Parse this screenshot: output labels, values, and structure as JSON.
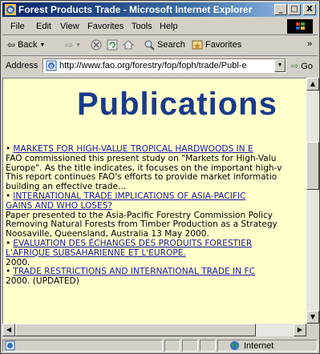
{
  "window": {
    "title": "Forest Products Trade - Microsoft Internet Explorer",
    "minimize_label": "_",
    "maximize_label": "□",
    "close_label": "X"
  },
  "menu": [
    "File",
    "Edit",
    "View",
    "Favorites",
    "Tools",
    "Help"
  ],
  "toolbar": {
    "back_label": "Back",
    "search_label": "Search",
    "favorites_label": "Favorites",
    "more_label": "»"
  },
  "address": {
    "label": "Address",
    "url": "http://www.fao.org/forestry/fop/foph/trade/Publ-e",
    "go_label": "Go"
  },
  "page": {
    "heading": "Publications",
    "entries": [
      {
        "link": "MARKETS FOR HIGH-VALUE TROPICAL HARDWOODS IN E",
        "desc": [
          "FAO commissioned this present study on \"Markets for High-Valu",
          "Europe\". As the title indicates, it focuses on the important high-v",
          "This report continues FAO's efforts to provide market informatio",
          "building an effective trade..."
        ]
      },
      {
        "link": "INTERNATIONAL TRADE IMPLICATIONS OF ASIA-PACIFIC",
        "link2": "GAINS AND WHO LOSES?",
        "desc": [
          "Paper presented to the Asia-Pacific Forestry Commission Policy",
          "Removing Natural Forests from Timber Production as a Strategy",
          "Noosaville, Queensland, Australia 13 May 2000."
        ]
      },
      {
        "link": "EVALUATION DES ÉCHANGES DES PRODUITS FORESTIER",
        "link2": "L'AFRIQUE SUBSAHARIENNE ET L'EUROPE.",
        "desc": [
          "2000."
        ]
      },
      {
        "link": "TRADE RESTRICTIONS AND INTERNATIONAL TRADE IN FC",
        "desc": [
          "2000. (UPDATED)"
        ]
      }
    ]
  },
  "status": {
    "zone": "Internet"
  }
}
